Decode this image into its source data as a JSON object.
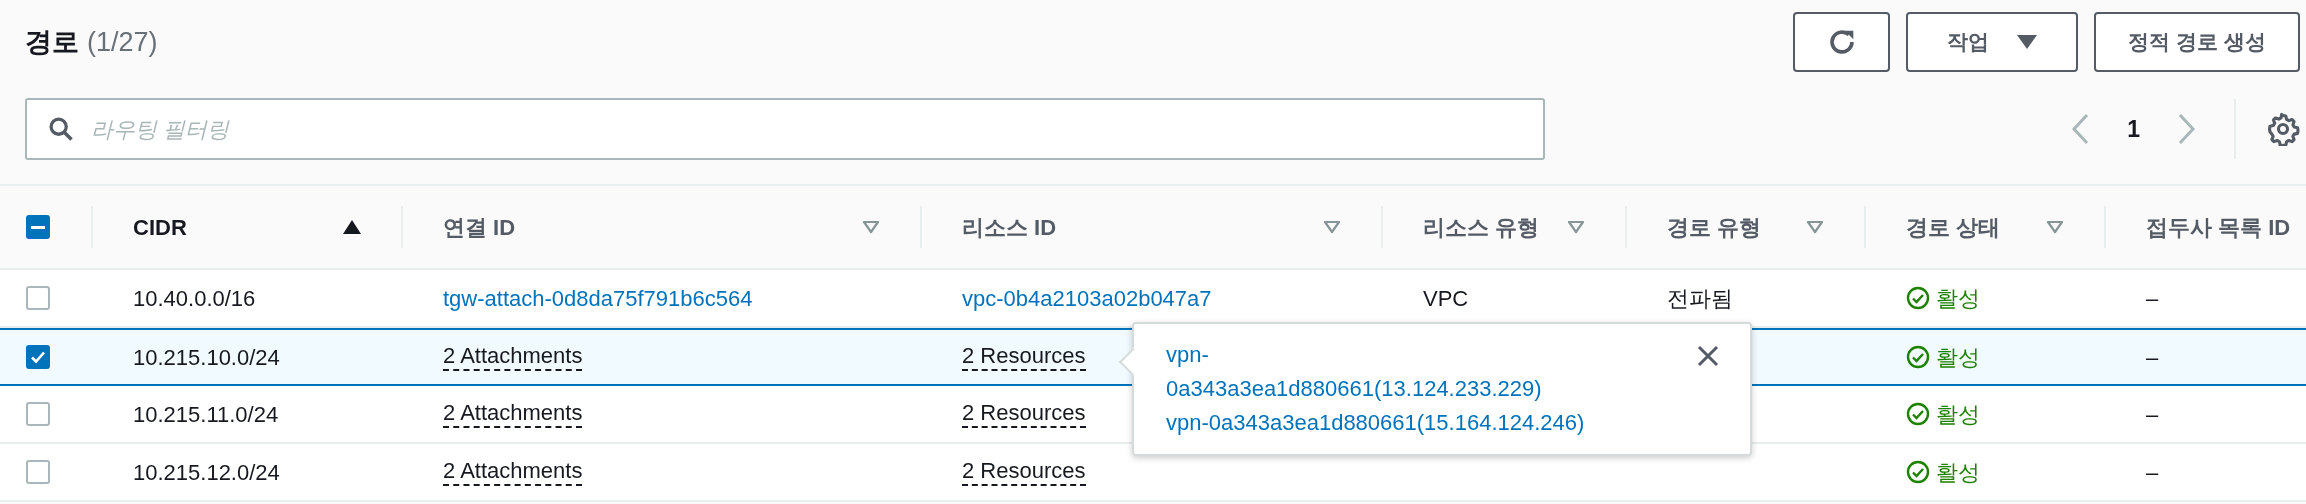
{
  "header": {
    "title": "경로",
    "count": "(1/27)"
  },
  "toolbar": {
    "actions": [
      {
        "kind": "refresh"
      },
      {
        "kind": "dropdown",
        "label": "작업"
      },
      {
        "kind": "plain",
        "label": "정적 경로 생성"
      }
    ]
  },
  "search": {
    "placeholder": "라우팅 필터링"
  },
  "pagination": {
    "prev_disabled": true,
    "pages": [
      {
        "label": "1",
        "selected": true
      }
    ],
    "next_disabled": true
  },
  "table": {
    "select_all": {
      "indeterminate": true
    },
    "columns": [
      {
        "label": "CIDR",
        "sorted": true
      },
      {
        "label": "연결 ID",
        "sorted": false
      },
      {
        "label": "리소스 ID",
        "sorted": false
      },
      {
        "label": "리소스 유형",
        "sorted": false
      },
      {
        "label": "경로 유형",
        "sorted": false
      },
      {
        "label": "경로 상태",
        "sorted": false
      },
      {
        "label": "접두사 목록 ID"
      }
    ],
    "rows": [
      {
        "checked": false,
        "cidr": "10.40.0.0/16",
        "attachment": {
          "kind": "link",
          "text": "tgw-attach-0d8da75f791b6c564"
        },
        "resource": {
          "kind": "link",
          "text": "vpc-0b4a2103a02b047a7"
        },
        "resource_type": "VPC",
        "route_type": "전파됨",
        "status": {
          "kind": "success",
          "text": "활성"
        },
        "prefix_list": "–"
      },
      {
        "checked": true,
        "cidr": "10.215.10.0/24",
        "attachment": {
          "kind": "tooltip",
          "text": "2 Attachments"
        },
        "resource": {
          "kind": "tooltip",
          "text": "2 Resources"
        },
        "status": {
          "kind": "success",
          "text": "활성"
        },
        "prefix_list": "–"
      },
      {
        "checked": false,
        "cidr": "10.215.11.0/24",
        "attachment": {
          "kind": "tooltip",
          "text": "2 Attachments"
        },
        "resource": {
          "kind": "tooltip",
          "text": "2 Resources"
        },
        "status": {
          "kind": "success",
          "text": "활성"
        },
        "prefix_list": "–"
      },
      {
        "checked": false,
        "cidr": "10.215.12.0/24",
        "attachment": {
          "kind": "tooltip",
          "text": "2 Attachments"
        },
        "resource": {
          "kind": "tooltip",
          "text": "2 Resources"
        },
        "status": {
          "kind": "success",
          "text": "활성"
        },
        "prefix_list": "–"
      }
    ]
  },
  "popover": {
    "links": [
      "vpn-0a343a3ea1d880661(13.124.233.229)",
      "vpn-0a343a3ea1d880661(15.164.124.246)"
    ]
  }
}
